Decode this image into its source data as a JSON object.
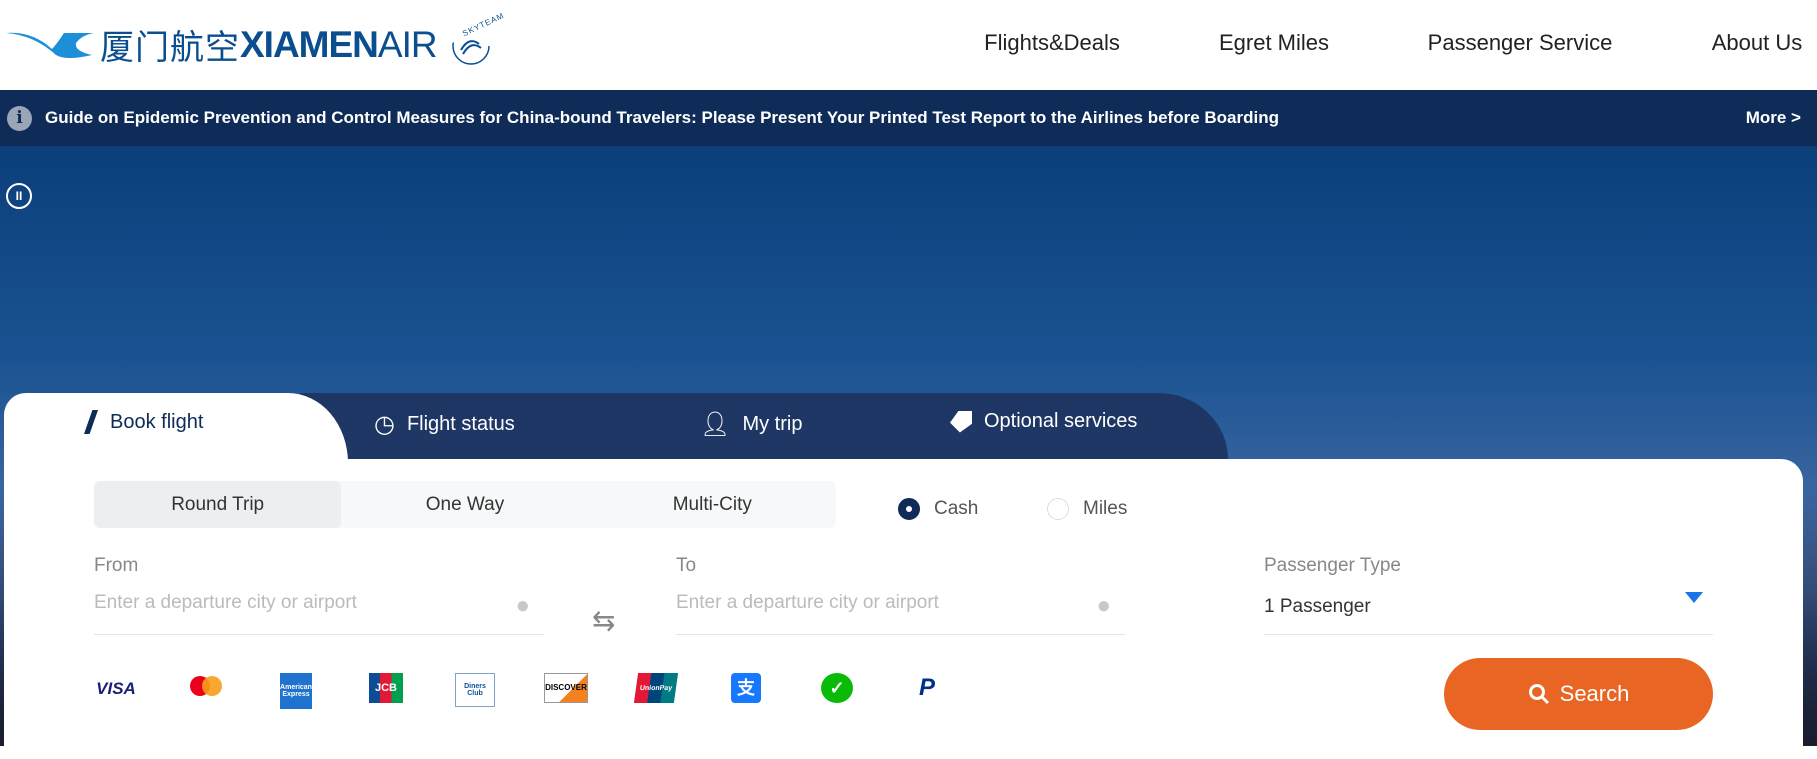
{
  "header": {
    "logo_cn": "厦门航空",
    "logo_en_bold": "XIAMEN",
    "logo_en_light": "AIR",
    "alliance": "SKYTEAM",
    "nav": [
      {
        "label": "Flights&Deals"
      },
      {
        "label": "Egret Miles"
      },
      {
        "label": "Passenger Service"
      },
      {
        "label": "About Us"
      }
    ]
  },
  "notice": {
    "icon": "info-icon",
    "text": "Guide on Epidemic Prevention and Control Measures for China-bound Travelers: Please Present Your Printed Test Report to the Airlines before Boarding",
    "more": "More >"
  },
  "booking": {
    "tabs": [
      {
        "label": "Book flight",
        "icon": "plane-tail-icon",
        "active": true
      },
      {
        "label": "Flight status",
        "icon": "clock-icon"
      },
      {
        "label": "My trip",
        "icon": "person-icon"
      },
      {
        "label": "Optional services",
        "icon": "tag-icon"
      }
    ],
    "trip_types": [
      {
        "label": "Round Trip",
        "selected": true
      },
      {
        "label": "One Way"
      },
      {
        "label": "Multi-City"
      }
    ],
    "payment_mode": [
      {
        "label": "Cash",
        "selected": true
      },
      {
        "label": "Miles",
        "selected": false
      }
    ],
    "from": {
      "label": "From",
      "placeholder": "Enter a departure city or airport"
    },
    "to": {
      "label": "To",
      "placeholder": "Enter a departure city or airport"
    },
    "passenger": {
      "label": "Passenger Type",
      "value": "1 Passenger"
    },
    "payment_methods": [
      "VISA",
      "mastercard",
      "American Express",
      "JCB",
      "Diners Club",
      "DISCOVER",
      "UnionPay",
      "Alipay",
      "WeChat Pay",
      "PayPal"
    ],
    "search_label": "Search"
  },
  "colors": {
    "navy": "#0e2c57",
    "accent": "#e96524",
    "brand": "#0b4e8f"
  }
}
